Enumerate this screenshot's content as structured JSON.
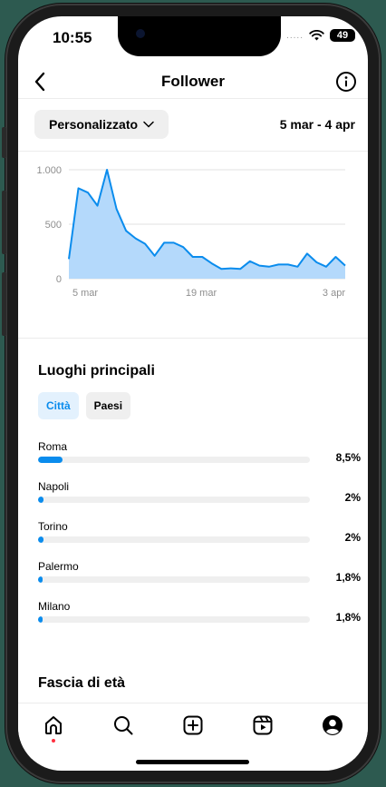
{
  "status_bar": {
    "time": "10:55",
    "signal_dots": ".....",
    "battery": "49"
  },
  "header": {
    "title": "Follower"
  },
  "period": {
    "selector_label": "Personalizzato",
    "date_range": "5 mar - 4 apr"
  },
  "chart_data": {
    "type": "area",
    "x_tick_labels": [
      "5 mar",
      "19 mar",
      "3 apr"
    ],
    "y_tick_labels": [
      "1.000",
      "500",
      "0"
    ],
    "ylim": [
      0,
      1000
    ],
    "grid": true,
    "color": "#0a8ced",
    "fill_color": "#b4d9fb",
    "series": [
      {
        "values": [
          180,
          830,
          790,
          670,
          1000,
          640,
          440,
          370,
          320,
          210,
          330,
          330,
          290,
          200,
          200,
          140,
          90,
          95,
          90,
          160,
          120,
          110,
          130,
          130,
          110,
          230,
          150,
          110,
          200,
          120
        ]
      }
    ]
  },
  "locations": {
    "title": "Luoghi principali",
    "tabs": [
      {
        "label": "Città",
        "active": true
      },
      {
        "label": "Paesi",
        "active": false
      }
    ],
    "items": [
      {
        "name": "Roma",
        "percent": "8,5%",
        "value": 8.5
      },
      {
        "name": "Napoli",
        "percent": "2%",
        "value": 2
      },
      {
        "name": "Torino",
        "percent": "2%",
        "value": 2
      },
      {
        "name": "Palermo",
        "percent": "1,8%",
        "value": 1.8
      },
      {
        "name": "Milano",
        "percent": "1,8%",
        "value": 1.8
      }
    ]
  },
  "age": {
    "title": "Fascia di età"
  },
  "nav": {
    "items": [
      {
        "icon": "home-icon",
        "active": true
      },
      {
        "icon": "search-icon"
      },
      {
        "icon": "create-icon"
      },
      {
        "icon": "reels-icon"
      },
      {
        "icon": "profile-icon"
      }
    ]
  },
  "colors": {
    "accent": "#0a8ced",
    "notification_dot": "#ff3040",
    "background": "#2d5a50"
  }
}
